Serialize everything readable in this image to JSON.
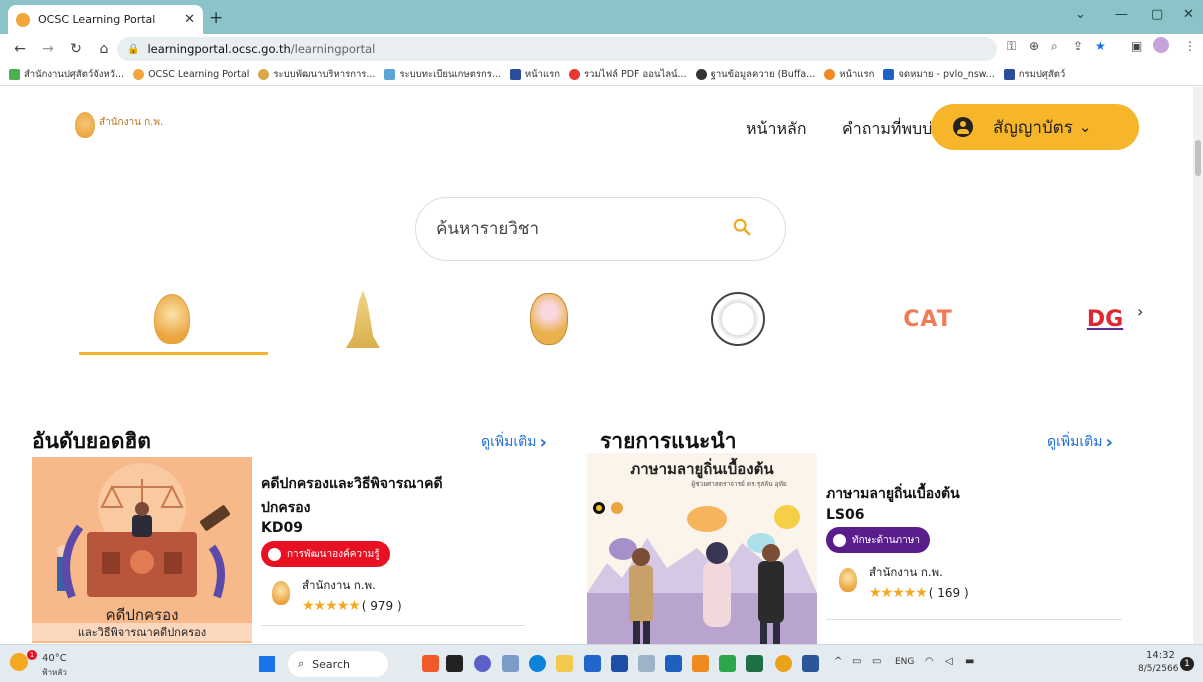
{
  "browser": {
    "tab_title": "OCSC Learning Portal",
    "url_host": "learningportal.ocsc.go.th",
    "url_path": "/learningportal",
    "bookmarks": [
      {
        "label": "สำนักงานปศุสัตว์จังหวั...",
        "color": "#4caf50"
      },
      {
        "label": "OCSC Learning Portal",
        "color": "#f3a63b"
      },
      {
        "label": "ระบบพัฒนาบริหารการ...",
        "color": "#d6a84b"
      },
      {
        "label": "ระบบทะเบียนเกษตรกร...",
        "color": "#5aa4d8"
      },
      {
        "label": "หน้าแรก",
        "color": "#2b4b9b"
      },
      {
        "label": "รวมไฟล์ PDF ออนไลน์...",
        "color": "#e53935"
      },
      {
        "label": "ฐานข้อมูลควาย (Buffa...",
        "color": "#333333"
      },
      {
        "label": "หน้าแรก",
        "color": "#f08a24"
      },
      {
        "label": "จดหมาย - pvlo_nsw...",
        "color": "#1e63c4"
      },
      {
        "label": "กรมปศุสัตว์",
        "color": "#2b4b9b"
      }
    ]
  },
  "header": {
    "logo_text": "สำนักงาน ก.พ.",
    "nav_home": "หน้าหลัก",
    "nav_faq": "คำถามที่พบบ่อย",
    "login_label": "สัญญาบัตร"
  },
  "search": {
    "placeholder": "ค้นหารายวิชา"
  },
  "agencies": {
    "cat": "CAT",
    "dg": "DG"
  },
  "popular": {
    "title": "อันดับยอดฮิต",
    "more": "ดูเพิ่มเติม",
    "course": {
      "title_line1": "คดีปกครองและวิธีพิจารณาคดี",
      "title_line2": "ปกครอง",
      "code": "KD09",
      "badge": "การพัฒนาองค์ความรู้",
      "provider": "สำนักงาน ก.พ.",
      "stars": "★★★★★",
      "count": "( 979 )",
      "thumb_title": "คดีปกครอง",
      "thumb_subtitle": "และวิธีพิจารณาคดีปกครอง"
    }
  },
  "recommend": {
    "title": "รายการแนะนำ",
    "more": "ดูเพิ่มเติม",
    "course": {
      "title": "ภาษามลายูถิ่นเบื้องต้น",
      "code": "LS06",
      "badge": "ทักษะด้านภาษา",
      "provider": "สำนักงาน ก.พ.",
      "stars": "★★★★★",
      "count": "( 169 )",
      "thumb_title": "ภาษามลายูถิ่นเบื้องต้น",
      "thumb_subtitle": "ผู้ช่วยศาสตราจารย์ ดร.รุสลัน อุทัย"
    }
  },
  "taskbar": {
    "weather_temp": "40°C",
    "weather_desc": "ฟ้าหลัว",
    "search_label": "Search",
    "lang": "ENG",
    "time": "14:32",
    "date": "8/5/2566",
    "notif_count": "1",
    "colors": {
      "badge_red": "#e81123",
      "badge_purple": "#5a1e8c",
      "accent": "#f7b52a",
      "link": "#1f6fd6"
    }
  }
}
